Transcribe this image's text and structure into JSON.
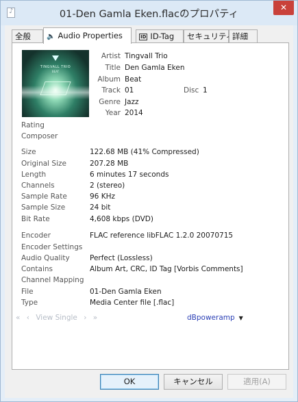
{
  "window": {
    "title": "01-Den Gamla Eken.flacのプロパティ",
    "close_glyph": "✕"
  },
  "tabs": [
    {
      "label": "全般"
    },
    {
      "label": "Audio Properties",
      "icon": "speaker-icon"
    },
    {
      "label": "ID-Tag",
      "icon_text": "ID"
    },
    {
      "label": "セキュリティ"
    },
    {
      "label": "詳細"
    }
  ],
  "cover": {
    "text": "TINGVALL TRIO",
    "subtext": "BEAT"
  },
  "meta": {
    "artist_label": "Artist",
    "artist": "Tingvall Trio",
    "title_label": "Title",
    "title": "Den Gamla Eken",
    "album_label": "Album",
    "album": "Beat",
    "track_label": "Track",
    "track": "01",
    "disc_label": "Disc",
    "disc": "1",
    "genre_label": "Genre",
    "genre": "Jazz",
    "year_label": "Year",
    "year": "2014"
  },
  "fields": {
    "rating_label": "Rating",
    "composer_label": "Composer",
    "size_label": "Size",
    "size": "122.68 MB  (41% Compressed)",
    "original_size_label": "Original Size",
    "original_size": "207.28 MB",
    "length_label": "Length",
    "length": "6 minutes 17 seconds",
    "channels_label": "Channels",
    "channels": "2  (stereo)",
    "sample_rate_label": "Sample Rate",
    "sample_rate": "96 KHz",
    "sample_size_label": "Sample Size",
    "sample_size": "24 bit",
    "bit_rate_label": "Bit Rate",
    "bit_rate": "4,608 kbps  (DVD)",
    "encoder_label": "Encoder",
    "encoder": "FLAC reference libFLAC 1.2.0 20070715",
    "encoder_settings_label": "Encoder Settings",
    "audio_quality_label": "Audio Quality",
    "audio_quality": "Perfect (Lossless)",
    "contains_label": "Contains",
    "contains": "Album Art, CRC, ID Tag [Vorbis Comments]",
    "channel_mapping_label": "Channel Mapping",
    "file_label": "File",
    "file": "01-Den Gamla Eken",
    "type_label": "Type",
    "type": "Media Center file    [.flac]"
  },
  "nav": {
    "first": "«",
    "prev": "‹",
    "view_single": "View Single",
    "next": "›",
    "last": "»"
  },
  "dbpoweramp": {
    "label": "dBpoweramp",
    "arrow": "▼"
  },
  "buttons": {
    "ok": "OK",
    "cancel": "キャンセル",
    "apply": "適用(A)"
  }
}
